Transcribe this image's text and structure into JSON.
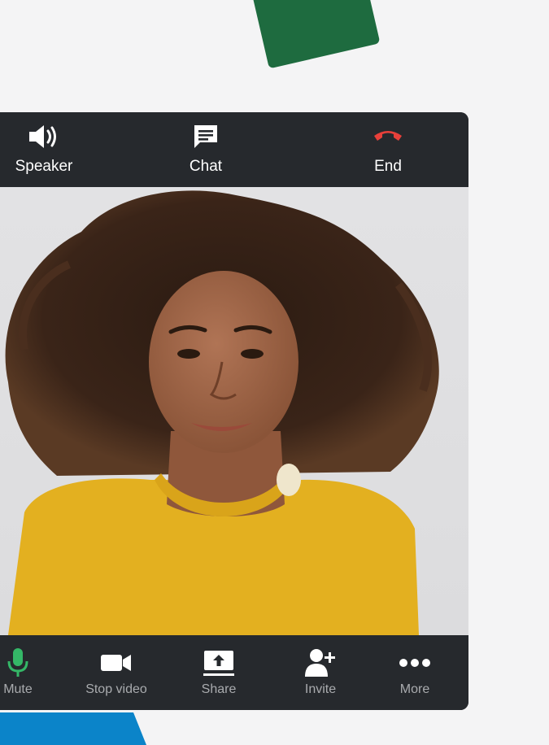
{
  "colors": {
    "background": "#f4f4f5",
    "toolbar": "#26292d",
    "end_call_red": "#e8403a",
    "mic_green": "#34b767",
    "deco_green": "#1e6b3f",
    "deco_blue": "#0b84c9",
    "shirt_yellow": "#e3b020"
  },
  "top_bar": {
    "speaker": {
      "label": "Speaker",
      "icon": "speaker-icon"
    },
    "chat": {
      "label": "Chat",
      "icon": "chat-icon"
    },
    "end": {
      "label": "End",
      "icon": "end-call-icon"
    }
  },
  "bottom_bar": {
    "mute": {
      "label": "Mute",
      "icon": "microphone-icon"
    },
    "stop_video": {
      "label": "Stop video",
      "icon": "video-camera-icon"
    },
    "share": {
      "label": "Share",
      "icon": "share-screen-icon"
    },
    "invite": {
      "label": "Invite",
      "icon": "add-person-icon"
    },
    "more": {
      "label": "More",
      "icon": "more-dots-icon"
    }
  }
}
